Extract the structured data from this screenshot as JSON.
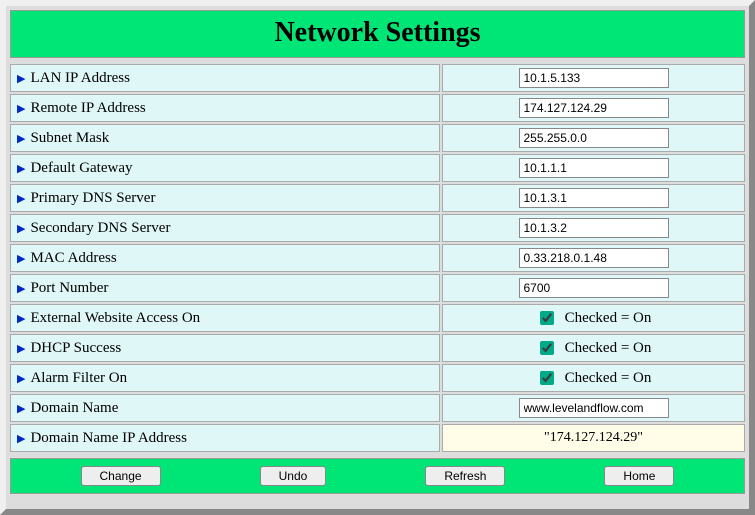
{
  "title": "Network Settings",
  "fields": {
    "lan_ip": {
      "label": "LAN IP Address",
      "value": "10.1.5.133"
    },
    "remote_ip": {
      "label": "Remote IP Address",
      "value": "174.127.124.29"
    },
    "subnet": {
      "label": "Subnet Mask",
      "value": "255.255.0.0"
    },
    "gateway": {
      "label": "Default Gateway",
      "value": "10.1.1.1"
    },
    "dns1": {
      "label": "Primary DNS Server",
      "value": "10.1.3.1"
    },
    "dns2": {
      "label": "Secondary DNS Server",
      "value": "10.1.3.2"
    },
    "mac": {
      "label": "MAC Address",
      "value": "0.33.218.0.1.48"
    },
    "port": {
      "label": "Port Number",
      "value": "6700"
    },
    "external_access": {
      "label": "External Website Access On",
      "hint": "Checked = On"
    },
    "dhcp": {
      "label": "DHCP Success",
      "hint": "Checked = On"
    },
    "alarm": {
      "label": "Alarm Filter On",
      "hint": "Checked = On"
    },
    "domain_name": {
      "label": "Domain Name",
      "value": "www.levelandflow.com"
    },
    "domain_ip": {
      "label": "Domain Name IP Address",
      "value": "\"174.127.124.29\""
    }
  },
  "buttons": {
    "change": "Change",
    "undo": "Undo",
    "refresh": "Refresh",
    "home": "Home"
  }
}
